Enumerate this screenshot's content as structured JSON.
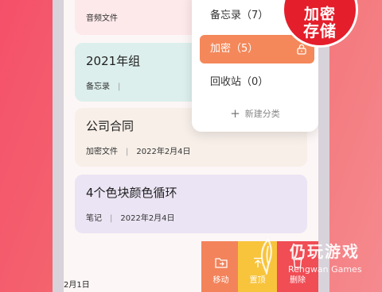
{
  "cards": [
    {
      "title": "",
      "meta_type": "音频文件",
      "meta_date": ""
    },
    {
      "title": "2021年组",
      "meta_type": "备忘录",
      "meta_date": ""
    },
    {
      "title": "公司合同",
      "meta_type": "加密文件",
      "meta_date": "2022年2月4日"
    },
    {
      "title": "4个色块颜色循环",
      "meta_type": "笔记",
      "meta_date": "2022年2月4日"
    }
  ],
  "bottom_date": "2月1日",
  "dropdown": {
    "items": [
      {
        "label": "备忘录（7）"
      },
      {
        "label": "加密（5）"
      },
      {
        "label": "回收站（0）"
      }
    ],
    "add_label": "新建分类"
  },
  "actions": {
    "move": "移动",
    "top": "置顶",
    "delete": "删除"
  },
  "badge": {
    "line1": "加密",
    "line2": "存储"
  },
  "watermark": {
    "cn": "仍玩游戏",
    "en": "Rengwan Games"
  },
  "colors": {
    "accent": "#f4885a",
    "move": "#f3835b",
    "top": "#f8c43c",
    "delete": "#f04d55",
    "badge": "#e41e2b"
  }
}
